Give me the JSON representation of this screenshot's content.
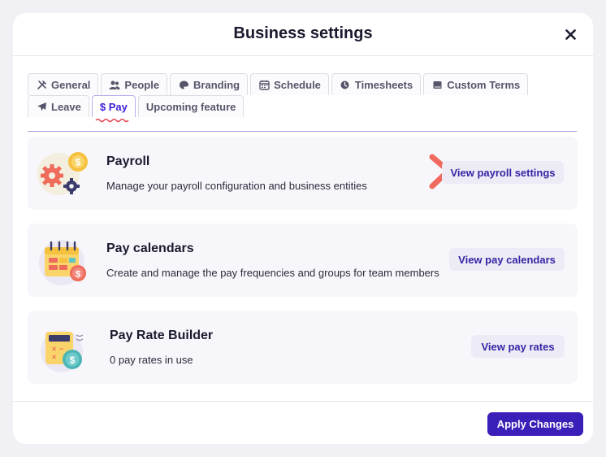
{
  "modal": {
    "title": "Business settings",
    "close_icon": "close-icon"
  },
  "tabs": {
    "row1": [
      {
        "label": "General",
        "icon": "tools-icon"
      },
      {
        "label": "People",
        "icon": "people-icon"
      },
      {
        "label": "Branding",
        "icon": "palette-icon"
      },
      {
        "label": "Schedule",
        "icon": "calendar-icon"
      },
      {
        "label": "Timesheets",
        "icon": "clock-icon"
      },
      {
        "label": "Custom Terms",
        "icon": "book-icon"
      }
    ],
    "row2": [
      {
        "label": "Leave",
        "icon": "plane-icon"
      },
      {
        "label": "$ Pay",
        "active": true
      },
      {
        "label": "Upcoming feature"
      }
    ]
  },
  "cards": [
    {
      "title": "Payroll",
      "description": "Manage your payroll configuration and business entities",
      "button": "View payroll settings",
      "icon": "payroll-gears-icon"
    },
    {
      "title": "Pay calendars",
      "description": "Create and manage the pay frequencies and groups for team members",
      "button": "View pay calendars",
      "icon": "pay-calendar-icon"
    },
    {
      "title": "Pay Rate Builder",
      "description": "0 pay rates in use",
      "button": "View pay rates",
      "icon": "pay-rate-calculator-icon"
    }
  ],
  "footer": {
    "apply_label": "Apply Changes"
  },
  "colors": {
    "accent": "#3b1fb8",
    "active_tab_text": "#3b1fd6",
    "pointer_arrow": "#f06a5f",
    "card_bg": "#f7f7fb",
    "secondary_button_bg": "#ecebf6"
  }
}
